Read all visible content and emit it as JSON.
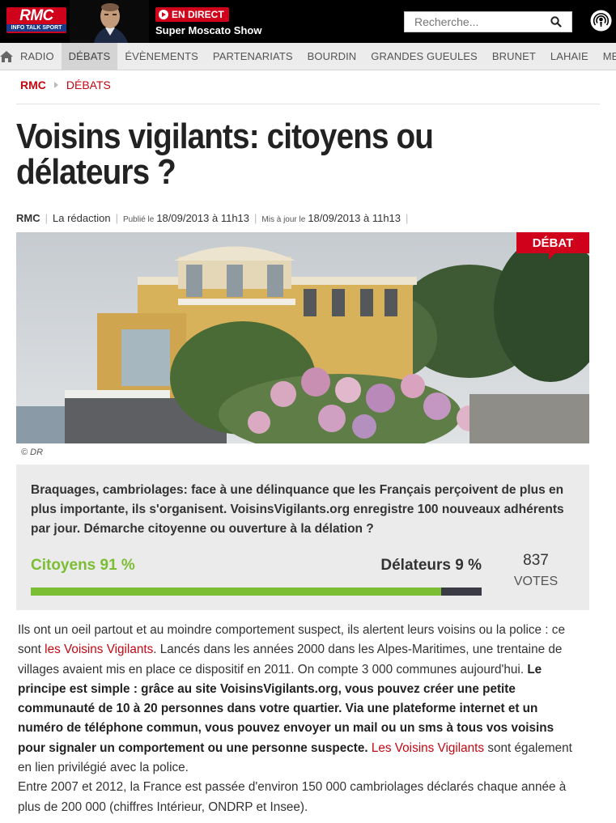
{
  "header": {
    "logo_main": "RMC",
    "logo_sub": "INFO TALK SPORT",
    "live_label": "EN DIRECT",
    "show_name": "Super Moscato Show",
    "search_placeholder": "Recherche..."
  },
  "nav": {
    "items": [
      "RADIO",
      "DÉBATS",
      "ÉVÈNEMENTS",
      "PARTENARIATS",
      "BOURDIN",
      "GRANDES GUEULES",
      "BRUNET",
      "LAHAIE",
      "MEDIAPLAN"
    ],
    "active_index": 1
  },
  "breadcrumb": {
    "root": "RMC",
    "section": "DÉBATS"
  },
  "article": {
    "title": "Voisins vigilants: citoyens ou délateurs ?",
    "source": "RMC",
    "author": "La rédaction",
    "published_prefix": "Publié le",
    "published": "18/09/2013 à 11h13",
    "updated_prefix": "Mis à jour le",
    "updated": "18/09/2013 à 11h13",
    "image_tag": "DÉBAT",
    "image_credit": "© DR"
  },
  "poll": {
    "question": "Braquages, cambriolages: face à une délinquance que les Français perçoivent de plus en plus importante, ils s'organisent. VoisinsVigilants.org enregistre 100 nouveaux adhérents par jour. Démarche citoyenne ou ouverture à la délation ?",
    "option_a": "Citoyens 91 %",
    "option_b": "Délateurs 9 %",
    "share_a": 0.91,
    "votes": "837",
    "votes_label": "VOTES",
    "colors": {
      "option_a": "#7cbe33",
      "option_b": "#3b3b45"
    }
  },
  "body": {
    "p1_a": "Ils ont un oeil partout et au moindre comportement suspect, ils alertent leurs voisins ou la police : ce sont ",
    "p1_link1": "les Voisins Vigilants",
    "p1_b": ". Lancés dans les années 2000 dans les Alpes-Maritimes, une trentaine de villages avaient mis en place ce dispositif en 2011. On compte 3 000 communes aujourd'hui. ",
    "p1_bold": "Le principe est simple : grâce au site VoisinsVigilants.org, vous pouvez créer une petite communauté de 10 à 20 personnes dans votre quartier. Via une plateforme internet et un numéro de téléphone commun, vous pouvez envoyer un mail ou un sms à tous vos voisins pour signaler un comportement ou une personne suspecte.",
    "p1_link2": "Les Voisins Vigilants",
    "p1_c": " sont également en lien privilégié avec la police.",
    "p2": "Entre 2007 et 2012, la France est passée d'environ 150 000 cambriolages déclarés chaque année à plus de 200 000 (chiffres Intérieur, ONDRP et Insee)."
  },
  "colors": {
    "brand_red": "#d0021b",
    "link_red": "#c20813"
  }
}
